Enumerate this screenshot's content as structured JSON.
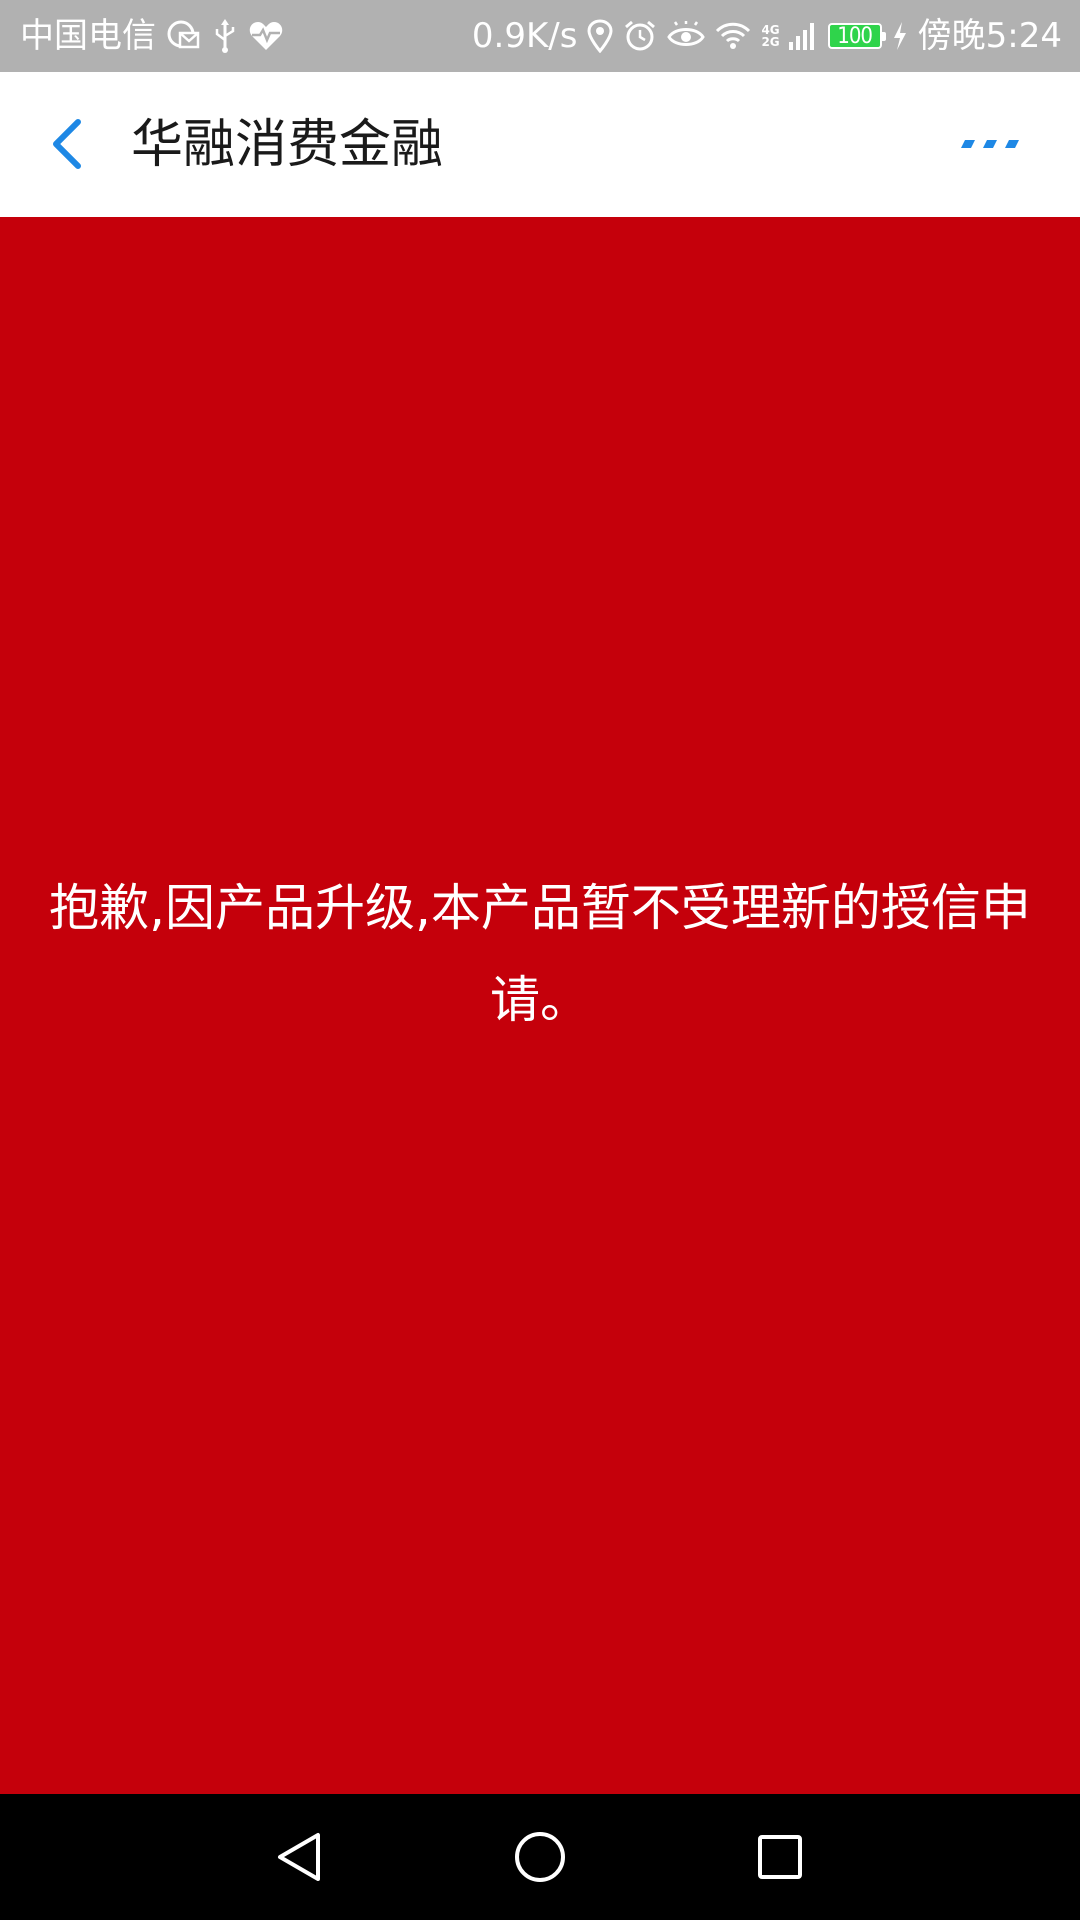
{
  "status_bar": {
    "carrier": "中国电信",
    "net_speed": "0.9K/s",
    "network_badge_top": "4G",
    "network_badge_bottom": "2G",
    "battery_level": "100",
    "time": "傍晚5:24",
    "icons": [
      "sim-message-icon",
      "usb-icon",
      "heart-rate-icon",
      "location-icon",
      "alarm-icon",
      "eye-care-icon",
      "wifi-icon",
      "cellular-signal-icon",
      "battery-icon",
      "charging-icon"
    ]
  },
  "app_bar": {
    "title": "华融消费金融",
    "back_icon": "chevron-left-icon",
    "more_icon": "more-icon",
    "accent_color": "#1e88e5"
  },
  "content": {
    "background_color": "#c5000b",
    "message": "抱歉,因产品升级,本产品暂不受理新的授信申请。"
  },
  "nav_bar": {
    "icons": [
      "nav-back-icon",
      "nav-home-icon",
      "nav-recent-icon"
    ]
  }
}
